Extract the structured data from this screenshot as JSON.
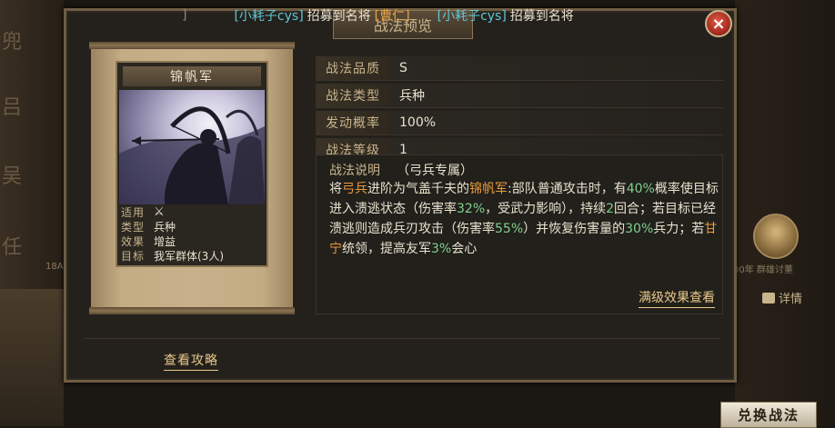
{
  "background": {
    "left_glyphs": [
      "兜",
      "吕",
      "吴",
      "任"
    ],
    "left_number": "18A",
    "right_caption": "00年 群雄讨董",
    "detail_label": "详情",
    "exchange_button": "兑换战法"
  },
  "ticker": {
    "left_fragment": "]",
    "msg1_user": "[小耗子cys]",
    "msg1_action": "招募到名将",
    "msg1_hero": "[曹仁]",
    "msg2_user": "[小耗子cys]",
    "msg2_action": "招募到名将"
  },
  "dialog": {
    "title": "战法预览",
    "close_label": "×"
  },
  "card": {
    "name": "锦帆军",
    "info": [
      {
        "key": "适用",
        "value": "⚔"
      },
      {
        "key": "类型",
        "value": "兵种"
      },
      {
        "key": "效果",
        "value": "增益"
      },
      {
        "key": "目标",
        "value": "我军群体(3人)"
      }
    ]
  },
  "attributes": [
    {
      "key": "战法品质",
      "value": "S"
    },
    {
      "key": "战法类型",
      "value": "兵种"
    },
    {
      "key": "发动概率",
      "value": "100%"
    },
    {
      "key": "战法等级",
      "value": "1"
    }
  ],
  "description": {
    "label": "战法说明",
    "restriction": "（弓兵专属）",
    "p1": "将",
    "p1_hl": "弓兵",
    "p2": "进阶为气盖千夫的",
    "p2_hl": "锦帆军",
    "p3": ":部队普通攻击时，有",
    "p3_hl": "40%",
    "p4": "概率使目标进入溃逃状态（伤害率",
    "p4_hl": "32%",
    "p5": "，受武力影响），持续",
    "p5_hl": "2",
    "p6": "回合；若目标已经溃逃则造成兵刃攻击（伤害率",
    "p6_hl": "55%",
    "p7": "）并恢复伤害量的",
    "p7_hl": "30%",
    "p8": "兵力；若",
    "p8_hl": "甘宁",
    "p9": "统领，提高友军",
    "p9_hl": "3%",
    "p10": "会心",
    "full_effect_link": "满级效果查看"
  },
  "guide_link": "查看攻略",
  "colors": {
    "highlight_orange": "#e89a3c",
    "highlight_green": "#7fd08e",
    "username_cyan": "#5fc6d8",
    "gold_text": "#c9b48c"
  }
}
